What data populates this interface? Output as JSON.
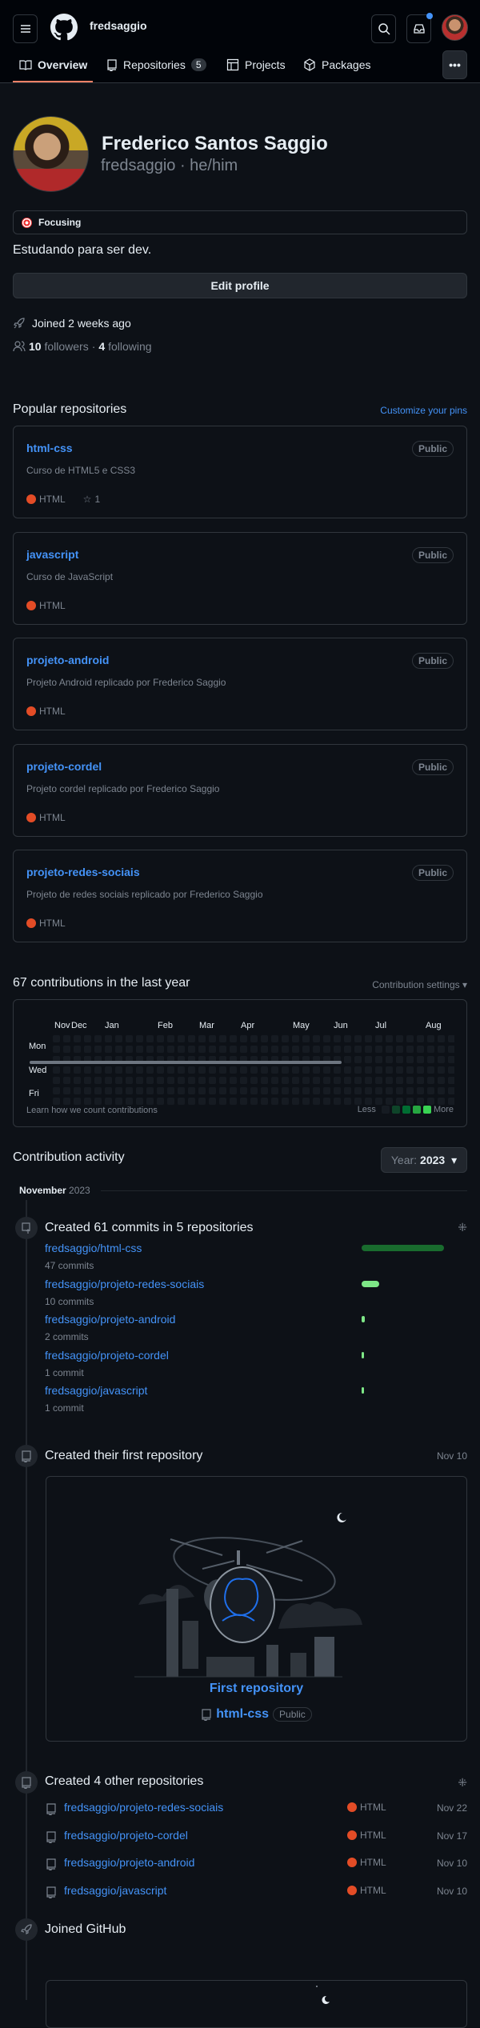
{
  "header": {
    "username": "fredsaggio",
    "icons": [
      "menu-icon",
      "github-logo",
      "search-icon",
      "inbox-icon",
      "avatar"
    ]
  },
  "tabs": [
    {
      "label": "Overview",
      "icon": "book-icon",
      "active": true
    },
    {
      "label": "Repositories",
      "icon": "repo-icon",
      "count": "5"
    },
    {
      "label": "Projects",
      "icon": "table-icon"
    },
    {
      "label": "Packages",
      "icon": "package-icon"
    }
  ],
  "profile": {
    "name": "Frederico Santos Saggio",
    "login_pronouns": "fredsaggio · he/him",
    "status": "Focusing",
    "bio": "Estudando para ser dev.",
    "edit_label": "Edit profile",
    "joined": "Joined 2 weeks ago",
    "followers": "10",
    "followers_label": "followers",
    "separator": "·",
    "following": "4",
    "following_label": "following"
  },
  "popular": {
    "title": "Popular repositories",
    "customize": "Customize your pins",
    "repos": [
      {
        "name": "html-css",
        "desc": "Curso de HTML5 e CSS3",
        "lang": "HTML",
        "stars": "1",
        "visibility": "Public"
      },
      {
        "name": "javascript",
        "desc": "Curso de JavaScript",
        "lang": "HTML",
        "visibility": "Public"
      },
      {
        "name": "projeto-android",
        "desc": "Projeto Android replicado por Frederico Saggio",
        "lang": "HTML",
        "visibility": "Public"
      },
      {
        "name": "projeto-cordel",
        "desc": "Projeto cordel replicado por Frederico Saggio",
        "lang": "HTML",
        "visibility": "Public"
      },
      {
        "name": "projeto-redes-sociais",
        "desc": "Projeto de redes sociais replicado por Frederico Saggio",
        "lang": "HTML",
        "visibility": "Public"
      }
    ]
  },
  "contrib": {
    "title": "67 contributions in the last year",
    "settings": "Contribution settings",
    "months": [
      "Nov",
      "Dec",
      "Jan",
      "Feb",
      "Mar",
      "Apr",
      "May",
      "Jun",
      "Jul",
      "Aug"
    ],
    "days": [
      "Mon",
      "Wed",
      "Fri"
    ],
    "learn": "Learn how we count contributions",
    "less": "Less",
    "more": "More",
    "level_colors": [
      "#161b22",
      "#0e4429",
      "#006d32",
      "#26a641",
      "#39d353"
    ]
  },
  "activity": {
    "title": "Contribution activity",
    "year_label": "Year:",
    "year": "2023",
    "month": "November",
    "month_year": "2023",
    "commits": {
      "title": "Created 61 commits in 5 repositories",
      "repos": [
        {
          "name": "fredsaggio/html-css",
          "count": "47 commits",
          "value": 47
        },
        {
          "name": "fredsaggio/projeto-redes-sociais",
          "count": "10 commits",
          "value": 10
        },
        {
          "name": "fredsaggio/projeto-android",
          "count": "2 commits",
          "value": 2
        },
        {
          "name": "fredsaggio/projeto-cordel",
          "count": "1 commit",
          "value": 1
        },
        {
          "name": "fredsaggio/javascript",
          "count": "1 commit",
          "value": 1
        }
      ]
    },
    "first": {
      "title": "Created their first repository",
      "date": "Nov 10",
      "caption": "First repository",
      "repo": "html-css",
      "visibility": "Public"
    },
    "others": {
      "title": "Created 4 other repositories",
      "repos": [
        {
          "name": "fredsaggio/projeto-redes-sociais",
          "lang": "HTML",
          "date": "Nov 22"
        },
        {
          "name": "fredsaggio/projeto-cordel",
          "lang": "HTML",
          "date": "Nov 17"
        },
        {
          "name": "fredsaggio/projeto-android",
          "lang": "HTML",
          "date": "Nov 10"
        },
        {
          "name": "fredsaggio/javascript",
          "lang": "HTML",
          "date": "Nov 10"
        }
      ]
    },
    "joined": {
      "title": "Joined GitHub"
    }
  }
}
